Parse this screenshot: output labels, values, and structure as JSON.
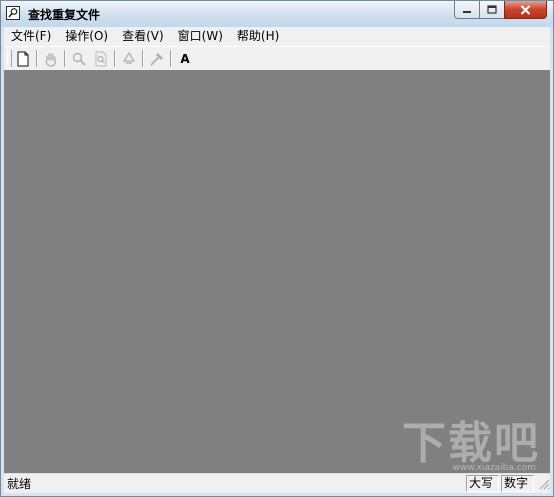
{
  "window": {
    "title": "查找重复文件",
    "buttons": [
      "minimize-icon",
      "maximize-icon",
      "close-icon"
    ]
  },
  "menu": {
    "items": [
      {
        "label": "文件(F)"
      },
      {
        "label": "操作(O)"
      },
      {
        "label": "查看(V)"
      },
      {
        "label": "窗口(W)"
      },
      {
        "label": "帮助(H)"
      }
    ]
  },
  "toolbar": {
    "buttons": [
      {
        "icon": "new-document-icon",
        "enabled": true
      },
      {
        "icon": "hand-icon",
        "enabled": false
      },
      {
        "icon": "search-icon",
        "enabled": false
      },
      {
        "icon": "search-document-icon",
        "enabled": false
      },
      {
        "icon": "recycle-icon",
        "enabled": false
      },
      {
        "icon": "hammer-icon",
        "enabled": false
      },
      {
        "icon": "font-icon",
        "label": "A",
        "enabled": true
      }
    ]
  },
  "client": {
    "background": "#808080"
  },
  "watermark": {
    "text": "下载吧",
    "sub": "www.xiazaiba.com"
  },
  "statusbar": {
    "text": "就绪",
    "panes": [
      "大写",
      "数字"
    ]
  }
}
